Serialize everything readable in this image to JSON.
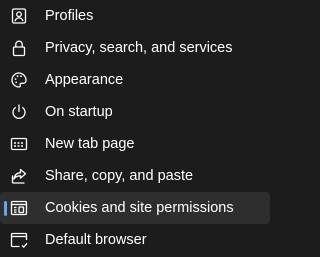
{
  "sidebar": {
    "accent_color": "#5ea8ef",
    "selected_background": "#2e2e2e",
    "background": "#1c1c1c",
    "items": [
      {
        "label": "Profiles",
        "icon": "profile-icon",
        "selected": false
      },
      {
        "label": "Privacy, search, and services",
        "icon": "lock-icon",
        "selected": false
      },
      {
        "label": "Appearance",
        "icon": "palette-icon",
        "selected": false
      },
      {
        "label": "On startup",
        "icon": "power-icon",
        "selected": false
      },
      {
        "label": "New tab page",
        "icon": "new-tab-icon",
        "selected": false
      },
      {
        "label": "Share, copy, and paste",
        "icon": "share-icon",
        "selected": false
      },
      {
        "label": "Cookies and site permissions",
        "icon": "site-permissions-icon",
        "selected": true
      },
      {
        "label": "Default browser",
        "icon": "default-browser-icon",
        "selected": false
      }
    ]
  }
}
